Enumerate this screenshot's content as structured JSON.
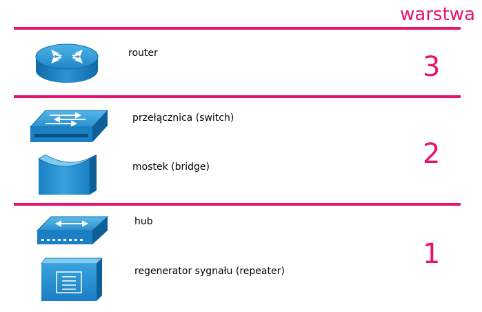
{
  "header": {
    "title": "warstwa"
  },
  "accent_color": "#e8126e",
  "device_color": "#1a7fc4",
  "layers": [
    {
      "number": "3",
      "devices": [
        {
          "icon": "router-icon",
          "label": "router"
        }
      ]
    },
    {
      "number": "2",
      "devices": [
        {
          "icon": "switch-icon",
          "label": "przełącznica (switch)"
        },
        {
          "icon": "bridge-icon",
          "label": "mostek (bridge)"
        }
      ]
    },
    {
      "number": "1",
      "devices": [
        {
          "icon": "hub-icon",
          "label": "hub"
        },
        {
          "icon": "repeater-icon",
          "label": "regenerator sygnału (repeater)"
        }
      ]
    }
  ]
}
